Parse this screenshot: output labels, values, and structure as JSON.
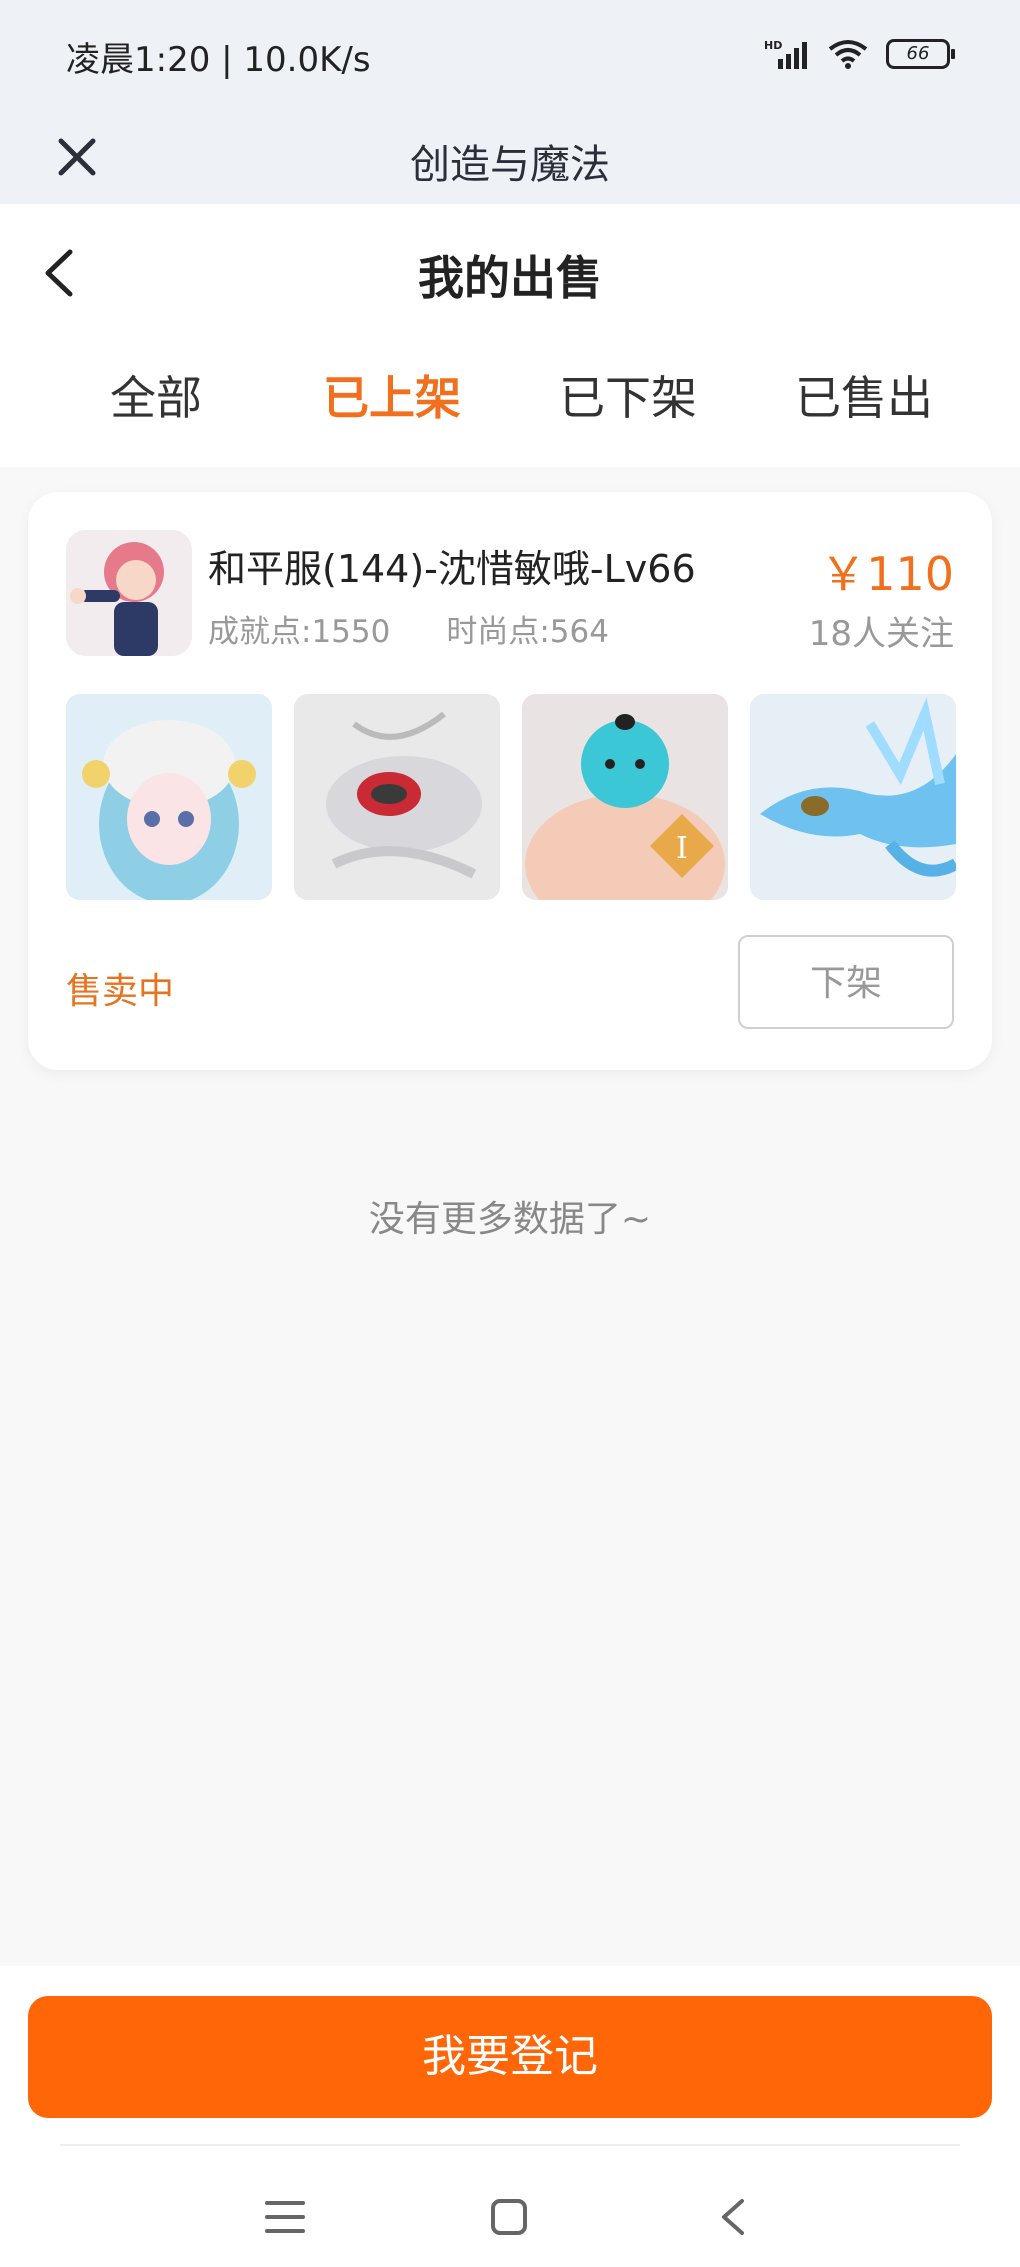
{
  "status_bar": {
    "time": "凌晨1:20 | 10.0K/s",
    "battery": "66",
    "network_badge": "HD"
  },
  "app_bar": {
    "title": "创造与魔法",
    "close_icon": "close-icon"
  },
  "header": {
    "title": "我的出售",
    "tabs": [
      {
        "label": "全部",
        "active": false
      },
      {
        "label": "已上架",
        "active": true
      },
      {
        "label": "已下架",
        "active": false
      },
      {
        "label": "已售出",
        "active": false
      }
    ]
  },
  "listing": {
    "title": "和平服(144)-沈惜敏哦-Lv66",
    "achievement": "成就点:1550",
    "fashion": "时尚点:564",
    "price": "￥110",
    "followers": "18人关注",
    "thumbnails": [
      "cloud-hair-doll",
      "white-mech-dragon",
      "blue-bird-gem",
      "ice-dragon"
    ],
    "status": "售卖中",
    "delist_label": "下架"
  },
  "footer_note": "没有更多数据了~",
  "primary_action": "我要登记",
  "colors": {
    "accent": "#f0701e",
    "button": "#ff6608",
    "background": "#f8f8f8"
  }
}
